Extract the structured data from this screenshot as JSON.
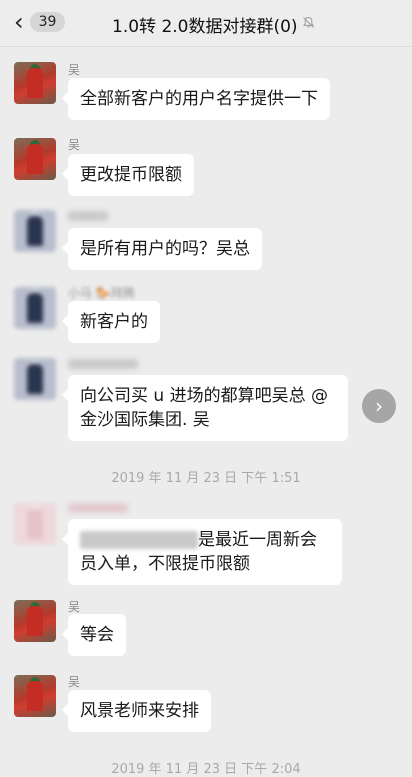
{
  "header": {
    "back_glyph": "‹",
    "unread_count": "39",
    "title": "1.0转 2.0数据对接群(0)",
    "mute_icon": "bell-off-icon"
  },
  "messages": [
    {
      "sender": "吴",
      "text": "全部新客户的用户名字提供一下"
    },
    {
      "sender": "吴",
      "text": "更改提币限额"
    },
    {
      "sender": "",
      "text": "是所有用户的吗？吴总"
    },
    {
      "sender": "小马 🐎拜腾",
      "text": "新客户的"
    },
    {
      "sender": "",
      "text_line1": "向公司买 u 进场的都算吧吴总 @",
      "text_line2": "金沙国际集团. 吴"
    },
    {
      "sender": "",
      "text_line1_tail": "是最近一周新会",
      "text_line2": "员入单，不限提币限额"
    },
    {
      "sender": "吴",
      "text": "等会"
    },
    {
      "sender": "吴",
      "text": "风景老师来安排"
    }
  ],
  "timestamps": [
    "2019 年 11 月 23 日  下午 1:51",
    "2019 年 11 月 23 日  下午 2:04"
  ],
  "forward_glyph": "›"
}
